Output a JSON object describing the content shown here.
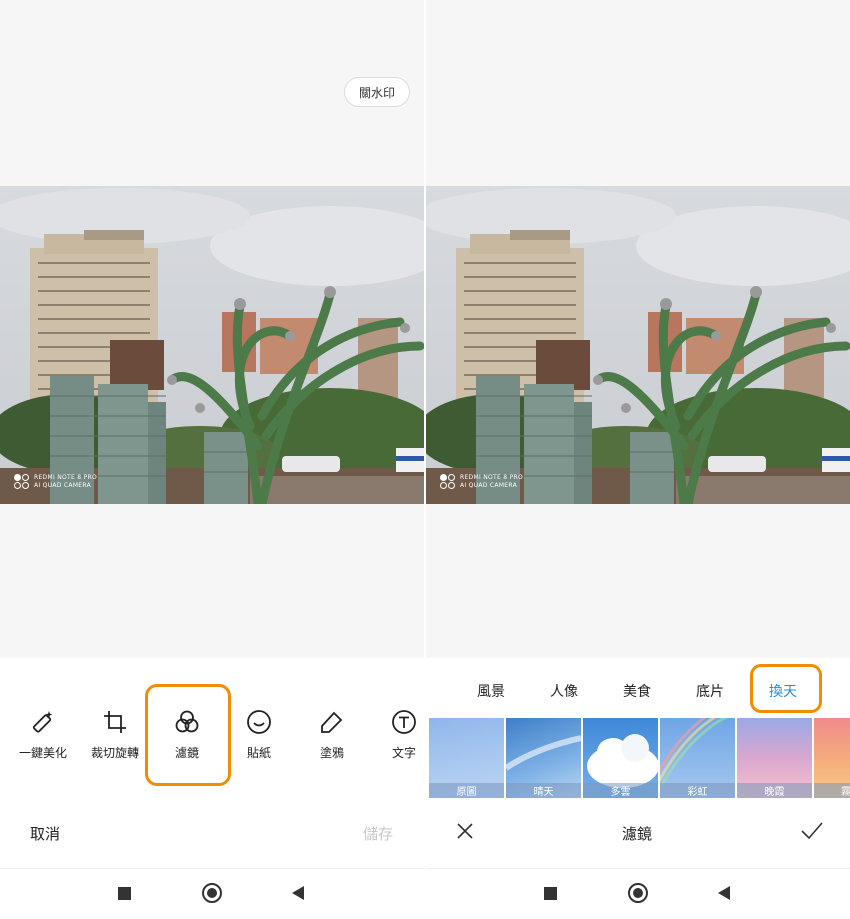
{
  "left_panel": {
    "watermark_button": "關水印",
    "camera_watermark": {
      "line1": "REDMI NOTE 8 PRO",
      "line2": "AI QUAD CAMERA"
    },
    "tools": [
      {
        "label": "一鍵美化",
        "icon": "magic-wand-icon"
      },
      {
        "label": "裁切旋轉",
        "icon": "crop-icon"
      },
      {
        "label": "濾鏡",
        "icon": "filter-icon"
      },
      {
        "label": "貼紙",
        "icon": "sticker-icon"
      },
      {
        "label": "塗鴉",
        "icon": "doodle-icon"
      },
      {
        "label": "文字",
        "icon": "text-icon"
      }
    ],
    "cancel_label": "取消",
    "save_label": "儲存"
  },
  "right_panel": {
    "categories": [
      "風景",
      "人像",
      "美食",
      "底片",
      "換天"
    ],
    "active_category": "換天",
    "filters": [
      "原圖",
      "晴天",
      "多雲",
      "彩虹",
      "晚霞",
      "霧"
    ],
    "title": "濾鏡"
  },
  "colors": {
    "highlight": "#f28c00",
    "active_tab": "#1e8fe0",
    "save_disabled": "#c8c8c8"
  }
}
